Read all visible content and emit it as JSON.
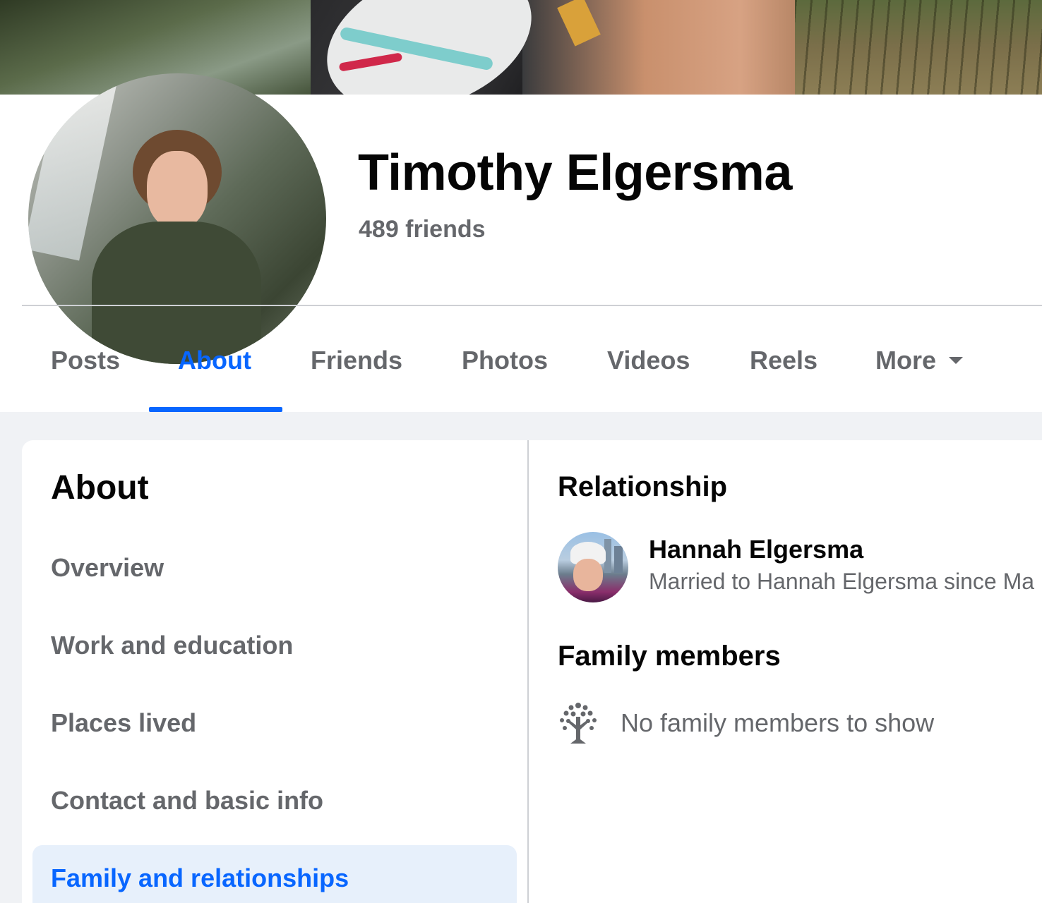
{
  "profile": {
    "name": "Timothy Elgersma",
    "friends": "489 friends"
  },
  "tabs": [
    {
      "label": "Posts"
    },
    {
      "label": "About"
    },
    {
      "label": "Friends"
    },
    {
      "label": "Photos"
    },
    {
      "label": "Videos"
    },
    {
      "label": "Reels"
    },
    {
      "label": "More"
    }
  ],
  "active_tab": "About",
  "about": {
    "title": "About",
    "nav": [
      {
        "label": "Overview"
      },
      {
        "label": "Work and education"
      },
      {
        "label": "Places lived"
      },
      {
        "label": "Contact and basic info"
      },
      {
        "label": "Family and relationships"
      }
    ],
    "active_nav": "Family and relationships"
  },
  "relationship": {
    "title": "Relationship",
    "person_name": "Hannah Elgersma",
    "status": "Married to Hannah Elgersma since Ma"
  },
  "family": {
    "title": "Family members",
    "empty_text": "No family members to show",
    "icon": "family-tree-icon"
  },
  "colors": {
    "accent": "#0866ff",
    "text_primary": "#050505",
    "text_secondary": "#65676b",
    "page_bg": "#f0f2f5",
    "active_nav_bg": "#e7f0fb"
  }
}
